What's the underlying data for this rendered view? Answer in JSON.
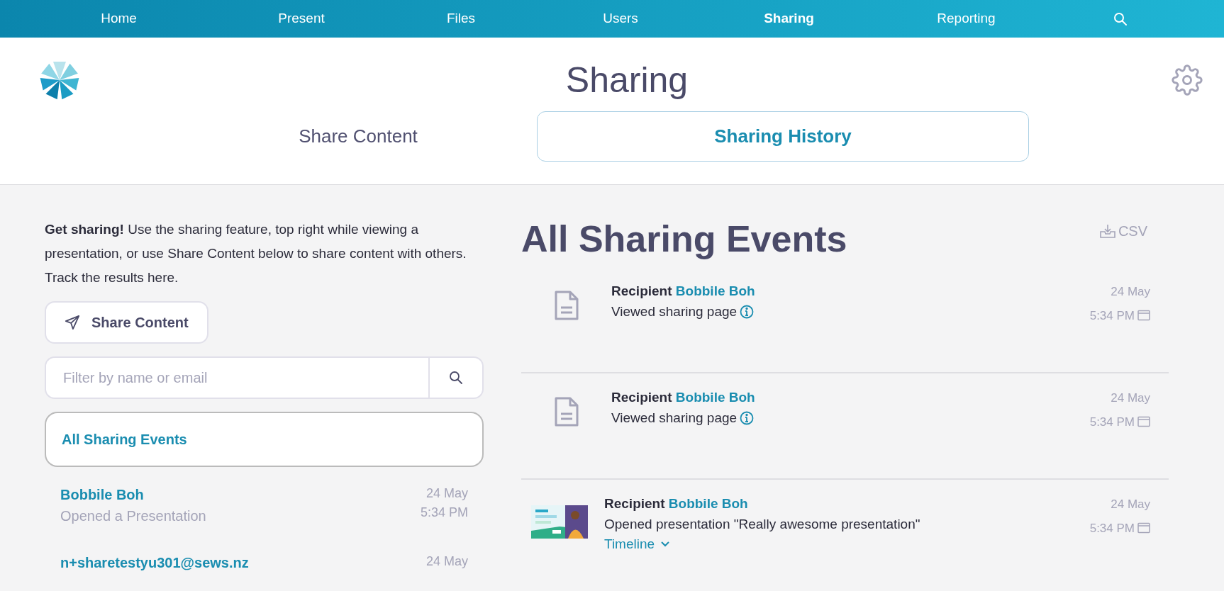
{
  "nav": {
    "items": [
      {
        "label": "Home",
        "selected": false
      },
      {
        "label": "Present",
        "selected": false
      },
      {
        "label": "Files",
        "selected": false
      },
      {
        "label": "Users",
        "selected": false
      },
      {
        "label": "Sharing",
        "selected": true
      },
      {
        "label": "Reporting",
        "selected": false
      }
    ]
  },
  "header": {
    "title": "Sharing",
    "tabs": [
      {
        "label": "Share Content",
        "selected": false
      },
      {
        "label": "Sharing History",
        "selected": true
      }
    ]
  },
  "intro": "**Get sharing!** Use the sharing feature, top right while viewing a presentation, or use Share Content below to share content with others. Track the results here.",
  "share_button": "Share Content",
  "filter": {
    "placeholder": "Filter by name or email"
  },
  "sidebar": {
    "items": [
      {
        "kind": "all",
        "title": "All Sharing Events",
        "selected": true
      },
      {
        "kind": "person",
        "title": "Bobbile Boh",
        "action": "Opened a Presentation",
        "date": "24 May",
        "time": "5:34 PM",
        "selected": false
      },
      {
        "kind": "person",
        "title": "n+sharetestyu301@sews.nz",
        "date": "24 May",
        "selected": false
      }
    ]
  },
  "events_heading": "All Sharing Events",
  "csv_label": "CSV",
  "events": [
    {
      "kind": "document",
      "label": "Recipient",
      "name": "Bobbile Boh",
      "action": "Viewed sharing page",
      "info": true,
      "date": "24 May",
      "time": "5:34 PM"
    },
    {
      "kind": "document",
      "label": "Recipient",
      "name": "Bobbile Boh",
      "action": "Viewed sharing page",
      "info": true,
      "date": "24 May",
      "time": "5:34 PM"
    },
    {
      "kind": "presentation",
      "label": "Recipient",
      "name": "Bobbile Boh",
      "action": "Opened presentation \"Really awesome presentation\"",
      "info": false,
      "date": "24 May",
      "time": "5:34 PM",
      "timeline": "Timeline"
    }
  ]
}
